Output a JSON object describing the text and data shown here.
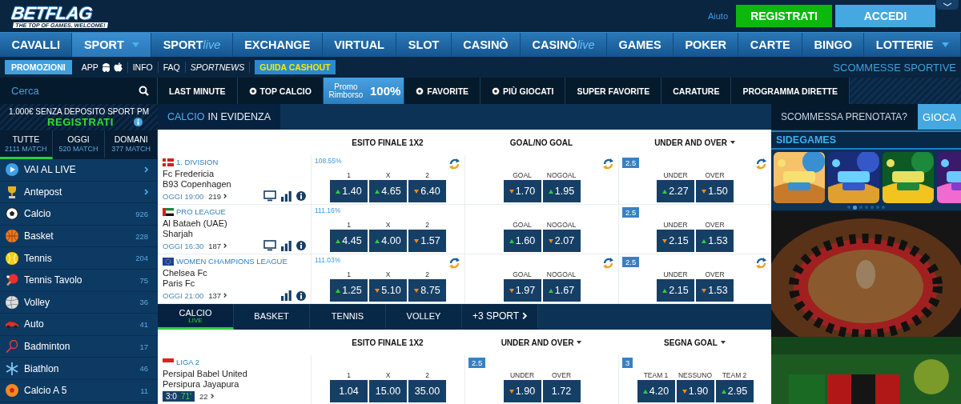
{
  "header": {
    "logo": "BETFLAG",
    "tagline": "THE TOP OF GAMES. WELCOME!",
    "help": "Aiuto",
    "buttons": [
      {
        "label": "REGISTRATI",
        "kind": "register"
      },
      {
        "label": "ACCEDI",
        "kind": "login"
      }
    ]
  },
  "main_nav": [
    {
      "label": "CAVALLI",
      "selected": false,
      "dropdown": false
    },
    {
      "label": "SPORT",
      "selected": true,
      "dropdown": true
    },
    {
      "label": "SPORT",
      "suffix": "live",
      "selected": false,
      "dropdown": false
    },
    {
      "label": "EXCHANGE",
      "selected": false,
      "dropdown": false
    },
    {
      "label": "VIRTUAL",
      "selected": false,
      "dropdown": false
    },
    {
      "label": "SLOT",
      "selected": false,
      "dropdown": false
    },
    {
      "label": "CASINÒ",
      "selected": false,
      "dropdown": false
    },
    {
      "label": "CASINÒ",
      "suffix": "live",
      "selected": false,
      "dropdown": false
    },
    {
      "label": "GAMES",
      "selected": false,
      "dropdown": false
    },
    {
      "label": "POKER",
      "selected": false,
      "dropdown": false
    },
    {
      "label": "CARTE",
      "selected": false,
      "dropdown": false
    },
    {
      "label": "BINGO",
      "selected": false,
      "dropdown": false
    },
    {
      "label": "LOTTERIE",
      "selected": false,
      "dropdown": true
    }
  ],
  "sub_nav": {
    "items": [
      {
        "label": "PROMOZIONI",
        "kind": "highlight"
      },
      {
        "label": "APP",
        "kind": "app"
      },
      {
        "label": "INFO",
        "kind": "plain"
      },
      {
        "label": "FAQ",
        "kind": "plain"
      },
      {
        "label": "SPORTNEWS",
        "kind": "italic"
      },
      {
        "label": "GUIDA CASHOUT",
        "kind": "promo"
      }
    ],
    "section": "SCOMMESSE SPORTIVE"
  },
  "search": {
    "placeholder": "Cerca"
  },
  "quick_tabs": [
    {
      "kind": "plain",
      "label": "LAST MINUTE"
    },
    {
      "kind": "ball",
      "label": "TOP CALCIO"
    },
    {
      "kind": "promo",
      "label": "Promo Rimborso",
      "value": "100%"
    },
    {
      "kind": "ball",
      "label": "FAVORITE"
    },
    {
      "kind": "ball",
      "label": "PIÙ GIOCATI"
    },
    {
      "kind": "plain",
      "label": "SUPER FAVORITE"
    },
    {
      "kind": "plain",
      "label": "CARATURE"
    },
    {
      "kind": "plain",
      "label": "PROGRAMMA DIRETTE"
    }
  ],
  "sidebar": {
    "promo": {
      "text": "1.000€ SENZA DEPOSITO SPORT PM",
      "cta": "REGISTRATI"
    },
    "date_tabs": [
      {
        "label": "TUTTE",
        "count": "2111 MATCH",
        "selected": true
      },
      {
        "label": "OGGI",
        "count": "520 MATCH",
        "selected": false
      },
      {
        "label": "DOMANI",
        "count": "377 MATCH",
        "selected": false
      }
    ],
    "sports": [
      {
        "name": "VAI AL LIVE",
        "kind": "link"
      },
      {
        "name": "Antepost",
        "kind": "link"
      },
      {
        "name": "Calcio",
        "kind": "count",
        "count": "926"
      },
      {
        "name": "Basket",
        "kind": "count",
        "count": "228"
      },
      {
        "name": "Tennis",
        "kind": "count",
        "count": "204"
      },
      {
        "name": "Tennis Tavolo",
        "kind": "count",
        "count": "75"
      },
      {
        "name": "Volley",
        "kind": "count",
        "count": "36"
      },
      {
        "name": "Auto",
        "kind": "count",
        "count": "41"
      },
      {
        "name": "Badminton",
        "kind": "count",
        "count": "17"
      },
      {
        "name": "Biathlon",
        "kind": "count",
        "count": "46"
      },
      {
        "name": "Calcio A 5",
        "kind": "count",
        "count": "11"
      }
    ]
  },
  "featured": {
    "sport": "CALCIO",
    "title": "IN EVIDENZA",
    "columns": [
      {
        "label": "ESITO FINALE 1X2",
        "dropdown": false
      },
      {
        "label": "GOAL/NO GOAL",
        "dropdown": false
      },
      {
        "label": "UNDER AND OVER",
        "dropdown": true
      }
    ],
    "matches": [
      {
        "flag": {
          "kind": "denmark"
        },
        "league": "1. DIVISION",
        "home": "Fc Fredericia",
        "away": "B93 Copenhagen",
        "time": "OGGI 19:00",
        "markets_count": "219",
        "tv": true,
        "stats": true,
        "info": true,
        "markets": [
          {
            "payout": "108.55%",
            "refresh": true,
            "outcomes": [
              {
                "label": "1",
                "odd": "1.40",
                "kind": "up"
              },
              {
                "label": "X",
                "odd": "4.65",
                "kind": "up"
              },
              {
                "label": "2",
                "odd": "6.40",
                "kind": "down"
              }
            ]
          },
          {
            "refresh": true,
            "outcomes": [
              {
                "label": "GOAL",
                "odd": "1.70",
                "kind": "down"
              },
              {
                "label": "NOGOAL",
                "odd": "1.95",
                "kind": "up"
              }
            ]
          },
          {
            "line": "2.5",
            "refresh": true,
            "outcomes": [
              {
                "label": "UNDER",
                "odd": "2.27",
                "kind": "up"
              },
              {
                "label": "OVER",
                "odd": "1.50",
                "kind": "down"
              }
            ]
          }
        ]
      },
      {
        "flag": {
          "kind": "emirates"
        },
        "league": "PRO LEAGUE",
        "home": "Al Bataeh (UAE)",
        "away": "Sharjah",
        "time": "OGGI 16:30",
        "markets_count": "187",
        "tv": true,
        "stats": true,
        "info": true,
        "markets": [
          {
            "payout": "111.16%",
            "refresh": false,
            "outcomes": [
              {
                "label": "1",
                "odd": "4.45",
                "kind": "up"
              },
              {
                "label": "X",
                "odd": "4.00",
                "kind": "up"
              },
              {
                "label": "2",
                "odd": "1.57",
                "kind": "down"
              }
            ]
          },
          {
            "refresh": false,
            "outcomes": [
              {
                "label": "GOAL",
                "odd": "1.60",
                "kind": "up"
              },
              {
                "label": "NOGOAL",
                "odd": "2.07",
                "kind": "down"
              }
            ]
          },
          {
            "line": "2.5",
            "refresh": false,
            "outcomes": [
              {
                "label": "UNDER",
                "odd": "2.15",
                "kind": "down"
              },
              {
                "label": "OVER",
                "odd": "1.53",
                "kind": "up"
              }
            ]
          }
        ]
      },
      {
        "flag": {
          "kind": "europe"
        },
        "league": "WOMEN CHAMPIONS LEAGUE",
        "home": "Chelsea Fc",
        "away": "Paris Fc",
        "time": "OGGI 21:00",
        "markets_count": "137",
        "tv": false,
        "stats": true,
        "info": true,
        "markets": [
          {
            "payout": "111.03%",
            "refresh": true,
            "outcomes": [
              {
                "label": "1",
                "odd": "1.25",
                "kind": "up"
              },
              {
                "label": "X",
                "odd": "5.10",
                "kind": "down"
              },
              {
                "label": "2",
                "odd": "8.75",
                "kind": "down"
              }
            ]
          },
          {
            "refresh": true,
            "outcomes": [
              {
                "label": "GOAL",
                "odd": "1.97",
                "kind": "down"
              },
              {
                "label": "NOGOAL",
                "odd": "1.67",
                "kind": "up"
              }
            ]
          },
          {
            "line": "2.5",
            "refresh": true,
            "outcomes": [
              {
                "label": "UNDER",
                "odd": "2.15",
                "kind": "up"
              },
              {
                "label": "OVER",
                "odd": "1.53",
                "kind": "down"
              }
            ]
          }
        ]
      }
    ]
  },
  "live": {
    "tabs": [
      {
        "label": "CALCIO",
        "sub": "LIVE",
        "kind": "sport",
        "selected": true
      },
      {
        "label": "BASKET",
        "kind": "sport",
        "selected": false
      },
      {
        "label": "TENNIS",
        "kind": "sport",
        "selected": false
      },
      {
        "label": "VOLLEY",
        "kind": "sport",
        "selected": false
      },
      {
        "label": "+3 SPORT",
        "kind": "more",
        "selected": false
      }
    ],
    "columns": [
      {
        "label": "ESITO FINALE 1X2",
        "dropdown": false
      },
      {
        "label": "UNDER AND OVER",
        "dropdown": true
      },
      {
        "label": "SEGNA GOAL",
        "dropdown": true
      }
    ],
    "matches": [
      {
        "flag": {
          "kind": "indonesia"
        },
        "league": "LIGA 2",
        "home": "Persipal Babel United",
        "away": "Persipura Jayapura",
        "score": "3:0",
        "minute": "71'",
        "markets_count": "22",
        "tv": false,
        "stats": false,
        "info": false,
        "markets": [
          {
            "refresh": false,
            "outcomes": [
              {
                "label": "1",
                "odd": "1.04",
                "kind": "none"
              },
              {
                "label": "X",
                "odd": "15.00",
                "kind": "none"
              },
              {
                "label": "2",
                "odd": "35.00",
                "kind": "none"
              }
            ]
          },
          {
            "line": "2.5",
            "refresh": false,
            "outcomes": [
              {
                "label": "UNDER",
                "odd": "1.90",
                "kind": "down"
              },
              {
                "label": "OVER",
                "odd": "1.72",
                "kind": "none"
              }
            ]
          },
          {
            "line": "3",
            "refresh": false,
            "outcomes": [
              {
                "label": "TEAM 1",
                "odd": "4.20",
                "kind": "up"
              },
              {
                "label": "NESSUNO",
                "odd": "1.90",
                "kind": "down"
              },
              {
                "label": "TEAM 2",
                "odd": "2.95",
                "kind": "up"
              }
            ]
          }
        ]
      }
    ]
  },
  "booking": {
    "placeholder": "SCOMMESSA PRENOTATA?",
    "button": "GIOCA"
  },
  "sidegames": {
    "title": "SIDEGAMES",
    "dots": [
      {
        "selected": false
      },
      {
        "selected": true
      },
      {
        "selected": false
      },
      {
        "selected": false
      },
      {
        "selected": false
      },
      {
        "selected": false
      },
      {
        "selected": false
      }
    ]
  }
}
